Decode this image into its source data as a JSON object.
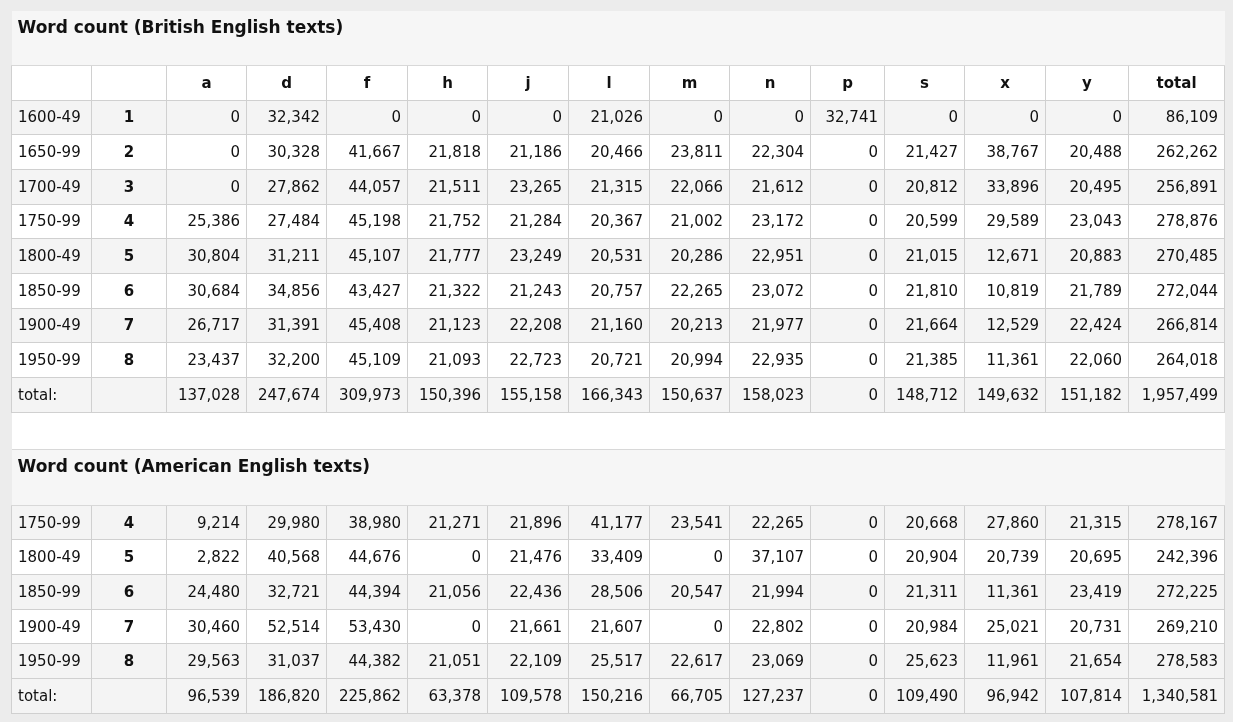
{
  "sections": [
    {
      "title": "Word count (British English texts)",
      "columns": [
        "a",
        "d",
        "f",
        "h",
        "j",
        "l",
        "m",
        "n",
        "p",
        "s",
        "x",
        "y",
        "total"
      ],
      "rows": [
        {
          "period": "1600-49",
          "index": "1",
          "values": [
            "0",
            "32,342",
            "0",
            "0",
            "0",
            "21,026",
            "0",
            "0",
            "32,741",
            "0",
            "0",
            "0",
            "86,109"
          ]
        },
        {
          "period": "1650-99",
          "index": "2",
          "values": [
            "0",
            "30,328",
            "41,667",
            "21,818",
            "21,186",
            "20,466",
            "23,811",
            "22,304",
            "0",
            "21,427",
            "38,767",
            "20,488",
            "262,262"
          ]
        },
        {
          "period": "1700-49",
          "index": "3",
          "values": [
            "0",
            "27,862",
            "44,057",
            "21,511",
            "23,265",
            "21,315",
            "22,066",
            "21,612",
            "0",
            "20,812",
            "33,896",
            "20,495",
            "256,891"
          ]
        },
        {
          "period": "1750-99",
          "index": "4",
          "values": [
            "25,386",
            "27,484",
            "45,198",
            "21,752",
            "21,284",
            "20,367",
            "21,002",
            "23,172",
            "0",
            "20,599",
            "29,589",
            "23,043",
            "278,876"
          ]
        },
        {
          "period": "1800-49",
          "index": "5",
          "values": [
            "30,804",
            "31,211",
            "45,107",
            "21,777",
            "23,249",
            "20,531",
            "20,286",
            "22,951",
            "0",
            "21,015",
            "12,671",
            "20,883",
            "270,485"
          ]
        },
        {
          "period": "1850-99",
          "index": "6",
          "values": [
            "30,684",
            "34,856",
            "43,427",
            "21,322",
            "21,243",
            "20,757",
            "22,265",
            "23,072",
            "0",
            "21,810",
            "10,819",
            "21,789",
            "272,044"
          ]
        },
        {
          "period": "1900-49",
          "index": "7",
          "values": [
            "26,717",
            "31,391",
            "45,408",
            "21,123",
            "22,208",
            "21,160",
            "20,213",
            "21,977",
            "0",
            "21,664",
            "12,529",
            "22,424",
            "266,814"
          ]
        },
        {
          "period": "1950-99",
          "index": "8",
          "values": [
            "23,437",
            "32,200",
            "45,109",
            "21,093",
            "22,723",
            "20,721",
            "20,994",
            "22,935",
            "0",
            "21,385",
            "11,361",
            "22,060",
            "264,018"
          ]
        }
      ],
      "total": {
        "label": "total:",
        "values": [
          "137,028",
          "247,674",
          "309,973",
          "150,396",
          "155,158",
          "166,343",
          "150,637",
          "158,023",
          "0",
          "148,712",
          "149,632",
          "151,182",
          "1,957,499"
        ]
      }
    },
    {
      "title": "Word count (American English texts)",
      "rows": [
        {
          "period": "1750-99",
          "index": "4",
          "values": [
            "9,214",
            "29,980",
            "38,980",
            "21,271",
            "21,896",
            "41,177",
            "23,541",
            "22,265",
            "0",
            "20,668",
            "27,860",
            "21,315",
            "278,167"
          ]
        },
        {
          "period": "1800-49",
          "index": "5",
          "values": [
            "2,822",
            "40,568",
            "44,676",
            "0",
            "21,476",
            "33,409",
            "0",
            "37,107",
            "0",
            "20,904",
            "20,739",
            "20,695",
            "242,396"
          ]
        },
        {
          "period": "1850-99",
          "index": "6",
          "values": [
            "24,480",
            "32,721",
            "44,394",
            "21,056",
            "22,436",
            "28,506",
            "20,547",
            "21,994",
            "0",
            "21,311",
            "11,361",
            "23,419",
            "272,225"
          ]
        },
        {
          "period": "1900-49",
          "index": "7",
          "values": [
            "30,460",
            "52,514",
            "53,430",
            "0",
            "21,661",
            "21,607",
            "0",
            "22,802",
            "0",
            "20,984",
            "25,021",
            "20,731",
            "269,210"
          ]
        },
        {
          "period": "1950-99",
          "index": "8",
          "values": [
            "29,563",
            "31,037",
            "44,382",
            "21,051",
            "22,109",
            "25,517",
            "22,617",
            "23,069",
            "0",
            "25,623",
            "11,961",
            "21,654",
            "278,583"
          ]
        }
      ],
      "total": {
        "label": "total:",
        "values": [
          "96,539",
          "186,820",
          "225,862",
          "63,378",
          "109,578",
          "150,216",
          "66,705",
          "127,237",
          "0",
          "109,490",
          "96,942",
          "107,814",
          "1,340,581"
        ]
      }
    }
  ]
}
